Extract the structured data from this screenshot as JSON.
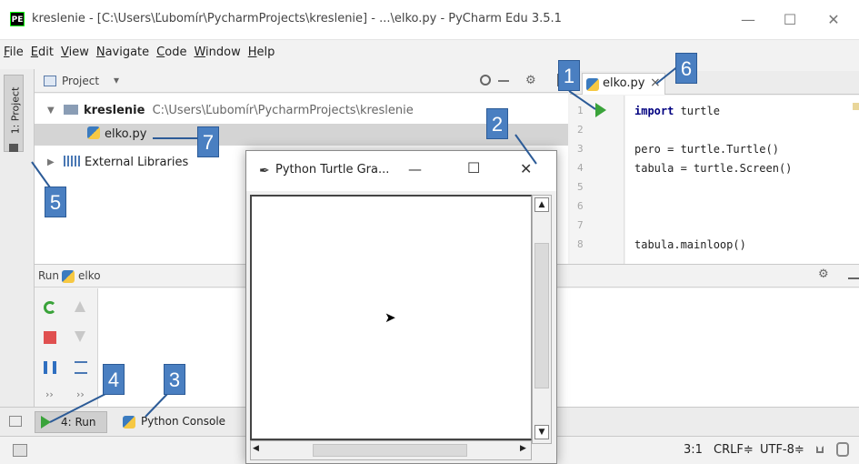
{
  "window": {
    "app_icon": "PE",
    "title": "kreslenie - [C:\\Users\\Ľubomír\\PycharmProjects\\kreslenie] - ...\\elko.py - PyCharm Edu 3.5.1",
    "minimize": "—",
    "maximize": "☐",
    "close": "✕"
  },
  "menu": [
    "File",
    "Edit",
    "View",
    "Navigate",
    "Code",
    "Window",
    "Help"
  ],
  "left_strip": {
    "project_tab": "1: Project"
  },
  "project": {
    "header_label": "Project",
    "dropdown": "▾",
    "tree": {
      "root_name": "kreslenie",
      "root_path": "C:\\Users\\Ľubomír\\PycharmProjects\\kreslenie",
      "file": "elko.py",
      "external": "External Libraries"
    }
  },
  "editor": {
    "tab_label": "elko.py",
    "tab_close": "×",
    "line_numbers": [
      "1",
      "2",
      "3",
      "4",
      "5",
      "6",
      "7",
      "8"
    ],
    "code": {
      "l1_kw": "import",
      "l1_rest": " turtle",
      "l3": "pero = turtle.Turtle()",
      "l4": "tabula = turtle.Screen()",
      "l8": "tabula.mainloop()"
    }
  },
  "run": {
    "label": "Run",
    "config": "elko"
  },
  "bottom_tabs": {
    "run": "4: Run",
    "console": "Python Console"
  },
  "status": {
    "position": "3:1",
    "line_sep": "CRLF≑",
    "encoding": "UTF-8≑"
  },
  "turtle": {
    "title": "Python Turtle Gra...",
    "minimize": "—",
    "maximize": "☐",
    "close": "✕",
    "cursor": "➤"
  },
  "callouts": [
    "1",
    "2",
    "3",
    "4",
    "5",
    "6",
    "7"
  ],
  "colors": {
    "callout": "#4a7fc1",
    "keyword": "#000080",
    "run_green": "#3aa33a",
    "stop_red": "#e05050"
  }
}
